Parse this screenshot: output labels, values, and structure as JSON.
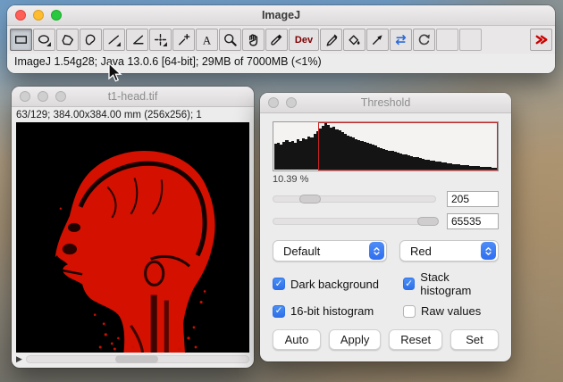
{
  "main_window": {
    "title": "ImageJ",
    "status": "ImageJ 1.54g28; Java 13.0.6 [64-bit]; 29MB of 7000MB (<1%)",
    "tools": [
      {
        "id": "rectangle",
        "icon": "rectangle",
        "selected": true
      },
      {
        "id": "oval",
        "icon": "oval",
        "has_menu": true
      },
      {
        "id": "polygon",
        "icon": "polygon"
      },
      {
        "id": "freehand",
        "icon": "freehand"
      },
      {
        "id": "line",
        "icon": "line",
        "has_menu": true
      },
      {
        "id": "angle",
        "icon": "angle"
      },
      {
        "id": "point",
        "icon": "point",
        "has_menu": true
      },
      {
        "id": "wand",
        "icon": "wand"
      },
      {
        "id": "text",
        "icon": "text"
      },
      {
        "id": "zoom",
        "icon": "zoom"
      },
      {
        "id": "hand",
        "icon": "hand"
      },
      {
        "id": "dropper",
        "icon": "dropper"
      },
      {
        "id": "dev",
        "label": "Dev"
      },
      {
        "id": "pencil",
        "icon": "pencil"
      },
      {
        "id": "flood-fill",
        "icon": "flood"
      },
      {
        "id": "arrow",
        "icon": "arrow"
      },
      {
        "id": "switch",
        "icon": "blue-arrows"
      },
      {
        "id": "rotate",
        "icon": "rotate"
      },
      {
        "id": "blank-1",
        "icon": "blank"
      },
      {
        "id": "blank-2",
        "icon": "blank"
      },
      {
        "id": "more",
        "icon": "more",
        "pushright": true
      }
    ]
  },
  "image_window": {
    "title": "t1-head.tif",
    "info": "63/129; 384.00x384.00 mm (256x256); 1",
    "play_icon": "▶"
  },
  "threshold_window": {
    "title": "Threshold",
    "percent_label": "10.39 %",
    "histogram": {
      "red_region_start_pct": 20,
      "bars": [
        55,
        58,
        54,
        60,
        63,
        59,
        62,
        57,
        65,
        61,
        68,
        66,
        72,
        70,
        76,
        82,
        88,
        95,
        100,
        96,
        90,
        93,
        87,
        84,
        80,
        77,
        74,
        71,
        69,
        66,
        64,
        61,
        59,
        57,
        55,
        53,
        51,
        49,
        47,
        45,
        43,
        41,
        40,
        38,
        36,
        35,
        33,
        32,
        30,
        29,
        27,
        26,
        25,
        23,
        22,
        21,
        20,
        19,
        18,
        17,
        16,
        15,
        14,
        13,
        12,
        12,
        11,
        10,
        10,
        9,
        8,
        8,
        7,
        7,
        6,
        6,
        5,
        5,
        4,
        4
      ]
    },
    "sliders": [
      {
        "name": "lower",
        "value": "205",
        "position_pct": 23
      },
      {
        "name": "upper",
        "value": "65535",
        "position_pct": 95
      }
    ],
    "method_select": "Default",
    "display_select": "Red",
    "checkboxes": [
      {
        "label": "Dark background",
        "checked": true
      },
      {
        "label": "Stack histogram",
        "checked": true
      },
      {
        "label": "16-bit histogram",
        "checked": true
      },
      {
        "label": "Raw values",
        "checked": false
      }
    ],
    "buttons": [
      "Auto",
      "Apply",
      "Reset",
      "Set"
    ],
    "colors": {
      "accent_blue": "#3478f6",
      "threshold_red": "#cc2222"
    }
  }
}
